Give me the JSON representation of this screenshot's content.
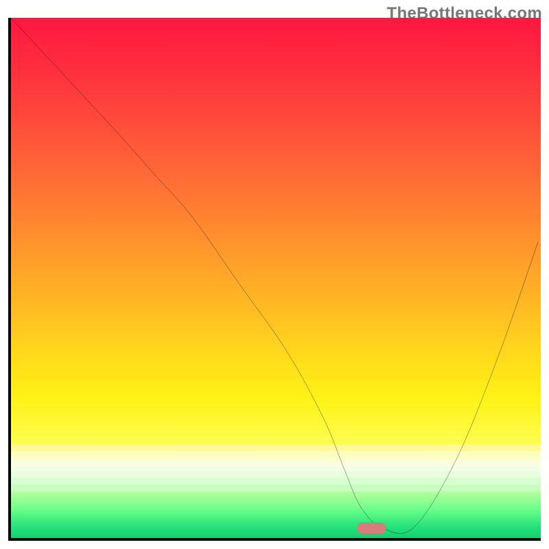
{
  "watermark": "TheBottleneck.com",
  "chart_data": {
    "type": "line",
    "title": "",
    "xlabel": "",
    "ylabel": "",
    "xlim": [
      0,
      100
    ],
    "ylim": [
      0,
      100
    ],
    "grid": false,
    "legend": false,
    "series": [
      {
        "name": "bottleneck-curve",
        "x": [
          0,
          10,
          20,
          27,
          34,
          43,
          52,
          59,
          63,
          66,
          70,
          76,
          84,
          92,
          99.5
        ],
        "values": [
          100,
          89,
          78,
          70,
          62,
          49,
          36,
          23,
          13,
          6,
          2,
          2,
          15,
          35,
          57
        ]
      }
    ],
    "marker": {
      "x": 68,
      "y": 2,
      "color": "#d97c7c"
    },
    "bands": {
      "pale_from": 82,
      "pale_to": 91,
      "stripes": [
        "#fff99a",
        "#fcffc2",
        "#faffd9",
        "#f3ffe6",
        "#e8ffdd",
        "#d8ffcf",
        "#c7ffbf"
      ],
      "green_from": 91,
      "green_to": 100
    }
  }
}
